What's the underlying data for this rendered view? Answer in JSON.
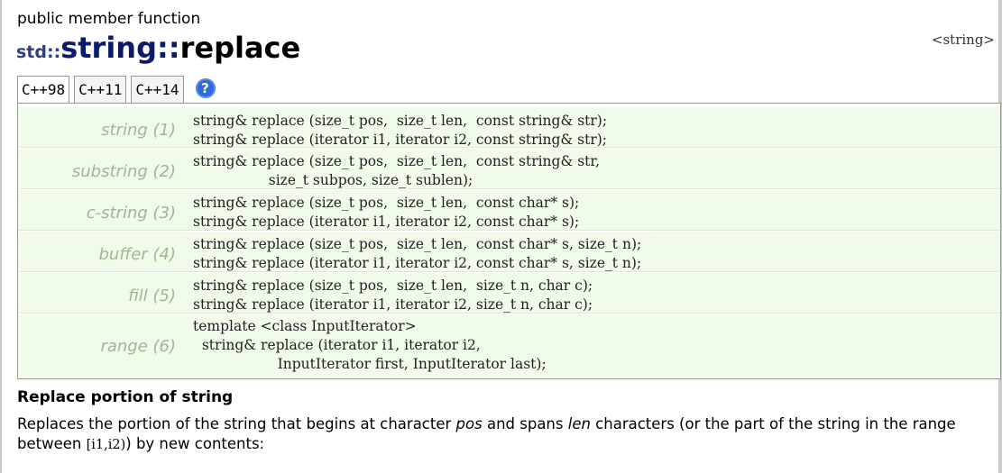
{
  "header": {
    "kind": "public member function",
    "namespace": "std::",
    "class_name": "string",
    "separator": "::",
    "function_name": "replace",
    "header_link": "<string>"
  },
  "tabs": [
    {
      "label": "C++98",
      "active": true
    },
    {
      "label": "C++11",
      "active": false
    },
    {
      "label": "C++14",
      "active": false
    }
  ],
  "help_icon": {
    "glyph": "?",
    "icon": "help-icon"
  },
  "prototypes": [
    {
      "label": "string (1)",
      "code": "string& replace (size_t pos,  size_t len,  const string& str);\nstring& replace (iterator i1, iterator i2, const string& str);"
    },
    {
      "label": "substring (2)",
      "code": "string& replace (size_t pos,  size_t len,  const string& str,\n                 size_t subpos, size_t sublen);"
    },
    {
      "label": "c-string (3)",
      "code": "string& replace (size_t pos,  size_t len,  const char* s);\nstring& replace (iterator i1, iterator i2, const char* s);"
    },
    {
      "label": "buffer (4)",
      "code": "string& replace (size_t pos,  size_t len,  const char* s, size_t n);\nstring& replace (iterator i1, iterator i2, const char* s, size_t n);"
    },
    {
      "label": "fill (5)",
      "code": "string& replace (size_t pos,  size_t len,  size_t n, char c);\nstring& replace (iterator i1, iterator i2, size_t n, char c);"
    },
    {
      "label": "range (6)",
      "code": "template <class InputIterator>\n  string& replace (iterator i1, iterator i2,\n                   InputIterator first, InputIterator last);"
    }
  ],
  "section": {
    "title": "Replace portion of string",
    "desc_part1": "Replaces the portion of the string that begins at character ",
    "desc_pos": "pos",
    "desc_part2": " and spans ",
    "desc_len": "len",
    "desc_part3": " characters (or the part of the string in the range between ",
    "desc_range": "[i1,i2)",
    "desc_part4": ") by new contents:"
  },
  "colors": {
    "title_class": "#0c1a6a",
    "row_background": "#f0fbea",
    "row_label": "#9fb894",
    "help_icon": "#2f6ad6"
  }
}
